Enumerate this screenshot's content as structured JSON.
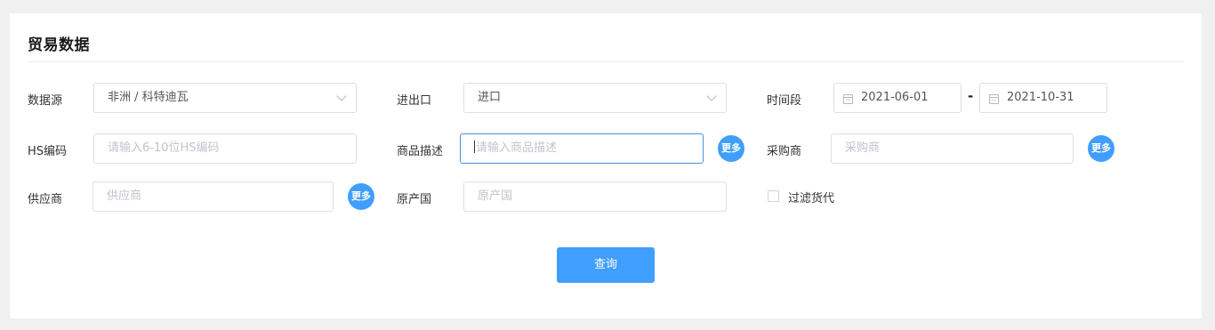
{
  "section_title": "贸易数据",
  "row1": {
    "source": {
      "label": "数据源",
      "value": "非洲 / 科特迪瓦"
    },
    "trade_direction": {
      "label": "进出口",
      "value": "进口"
    },
    "period": {
      "label": "时间段",
      "start": "2021-06-01",
      "separator": "-",
      "end": "2021-10-31"
    }
  },
  "row2": {
    "hs_code": {
      "label": "HS编码",
      "placeholder": "请输入6-10位HS编码"
    },
    "product_desc": {
      "label": "商品描述",
      "placeholder": "请输入商品描述",
      "more_label": "更多"
    },
    "buyer": {
      "label": "采购商",
      "placeholder": "采购商",
      "more_label": "更多"
    }
  },
  "row3": {
    "supplier": {
      "label": "供应商",
      "placeholder": "供应商",
      "more_label": "更多"
    },
    "origin": {
      "label": "原产国",
      "placeholder": "原产国"
    },
    "filter_forwarder": {
      "label": "过滤货代",
      "checked": false
    }
  },
  "query_button": "查询",
  "colors": {
    "accent": "#409eff",
    "focus_border": "#4a90e2",
    "page_bg": "#f0f0f0"
  },
  "icons": [
    "chevron-down-icon",
    "calendar-icon"
  ]
}
